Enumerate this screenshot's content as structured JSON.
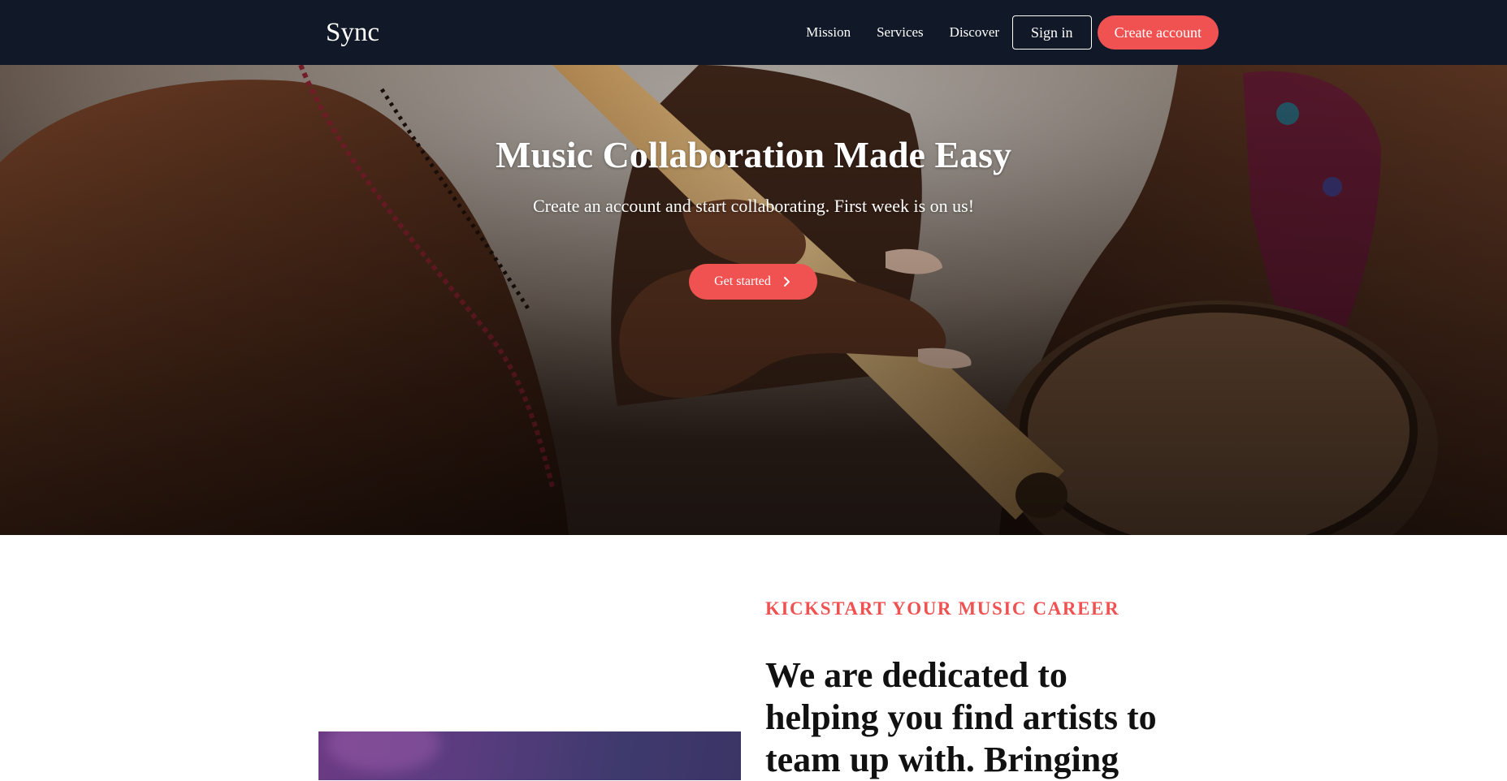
{
  "nav": {
    "brand": "Sync",
    "links": [
      "Mission",
      "Services",
      "Discover"
    ],
    "sign_in": "Sign in",
    "create_account": "Create account"
  },
  "hero": {
    "title": "Music Collaboration Made Easy",
    "subtitle": "Create an account and start collaborating. First week is on us!",
    "cta_label": "Get started",
    "cta_icon": "chevron-right-icon"
  },
  "section": {
    "eyebrow": "KICKSTART YOUR MUSIC CAREER",
    "headline": "We are dedicated to helping you find artists to team up with. Bringing"
  },
  "colors": {
    "nav_bg": "#111827",
    "accent": "#f05252",
    "text_light": "#ffffff",
    "text_dark": "#111111"
  }
}
